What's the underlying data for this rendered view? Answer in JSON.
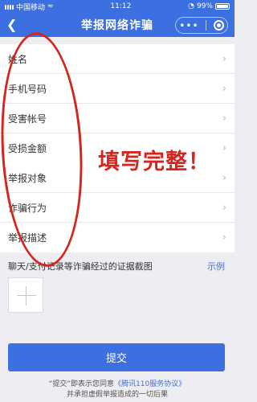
{
  "status_bar": {
    "carrier": "中国移动",
    "time": "11:12",
    "battery": "99%"
  },
  "nav": {
    "title": "举报网络诈骗",
    "back_icon": "chevron-left-icon",
    "more_icon": "more-dots-icon",
    "close_icon": "target-circle-icon"
  },
  "form": {
    "group1": [
      {
        "label": "姓名"
      },
      {
        "label": "手机号码"
      },
      {
        "label": "受害帐号"
      },
      {
        "label": "受损金额"
      }
    ],
    "group2": [
      {
        "label": "举报对象"
      },
      {
        "label": "诈骗行为"
      },
      {
        "label": "举报描述"
      }
    ],
    "evidence_label": "聊天/支付记录等诈骗经过的证据截图",
    "example_link": "示例"
  },
  "submit_label": "提交",
  "agreement": {
    "line1_prefix": "“提交”即表示您同意",
    "line1_link": "《腾讯110服务协议》",
    "line2": "并承担虚假举报造成的一切后果"
  },
  "annotation": {
    "text": "填写完整！",
    "color": "#d2261f"
  },
  "colors": {
    "primary": "#3c6fe0",
    "background": "#eeeef2"
  }
}
